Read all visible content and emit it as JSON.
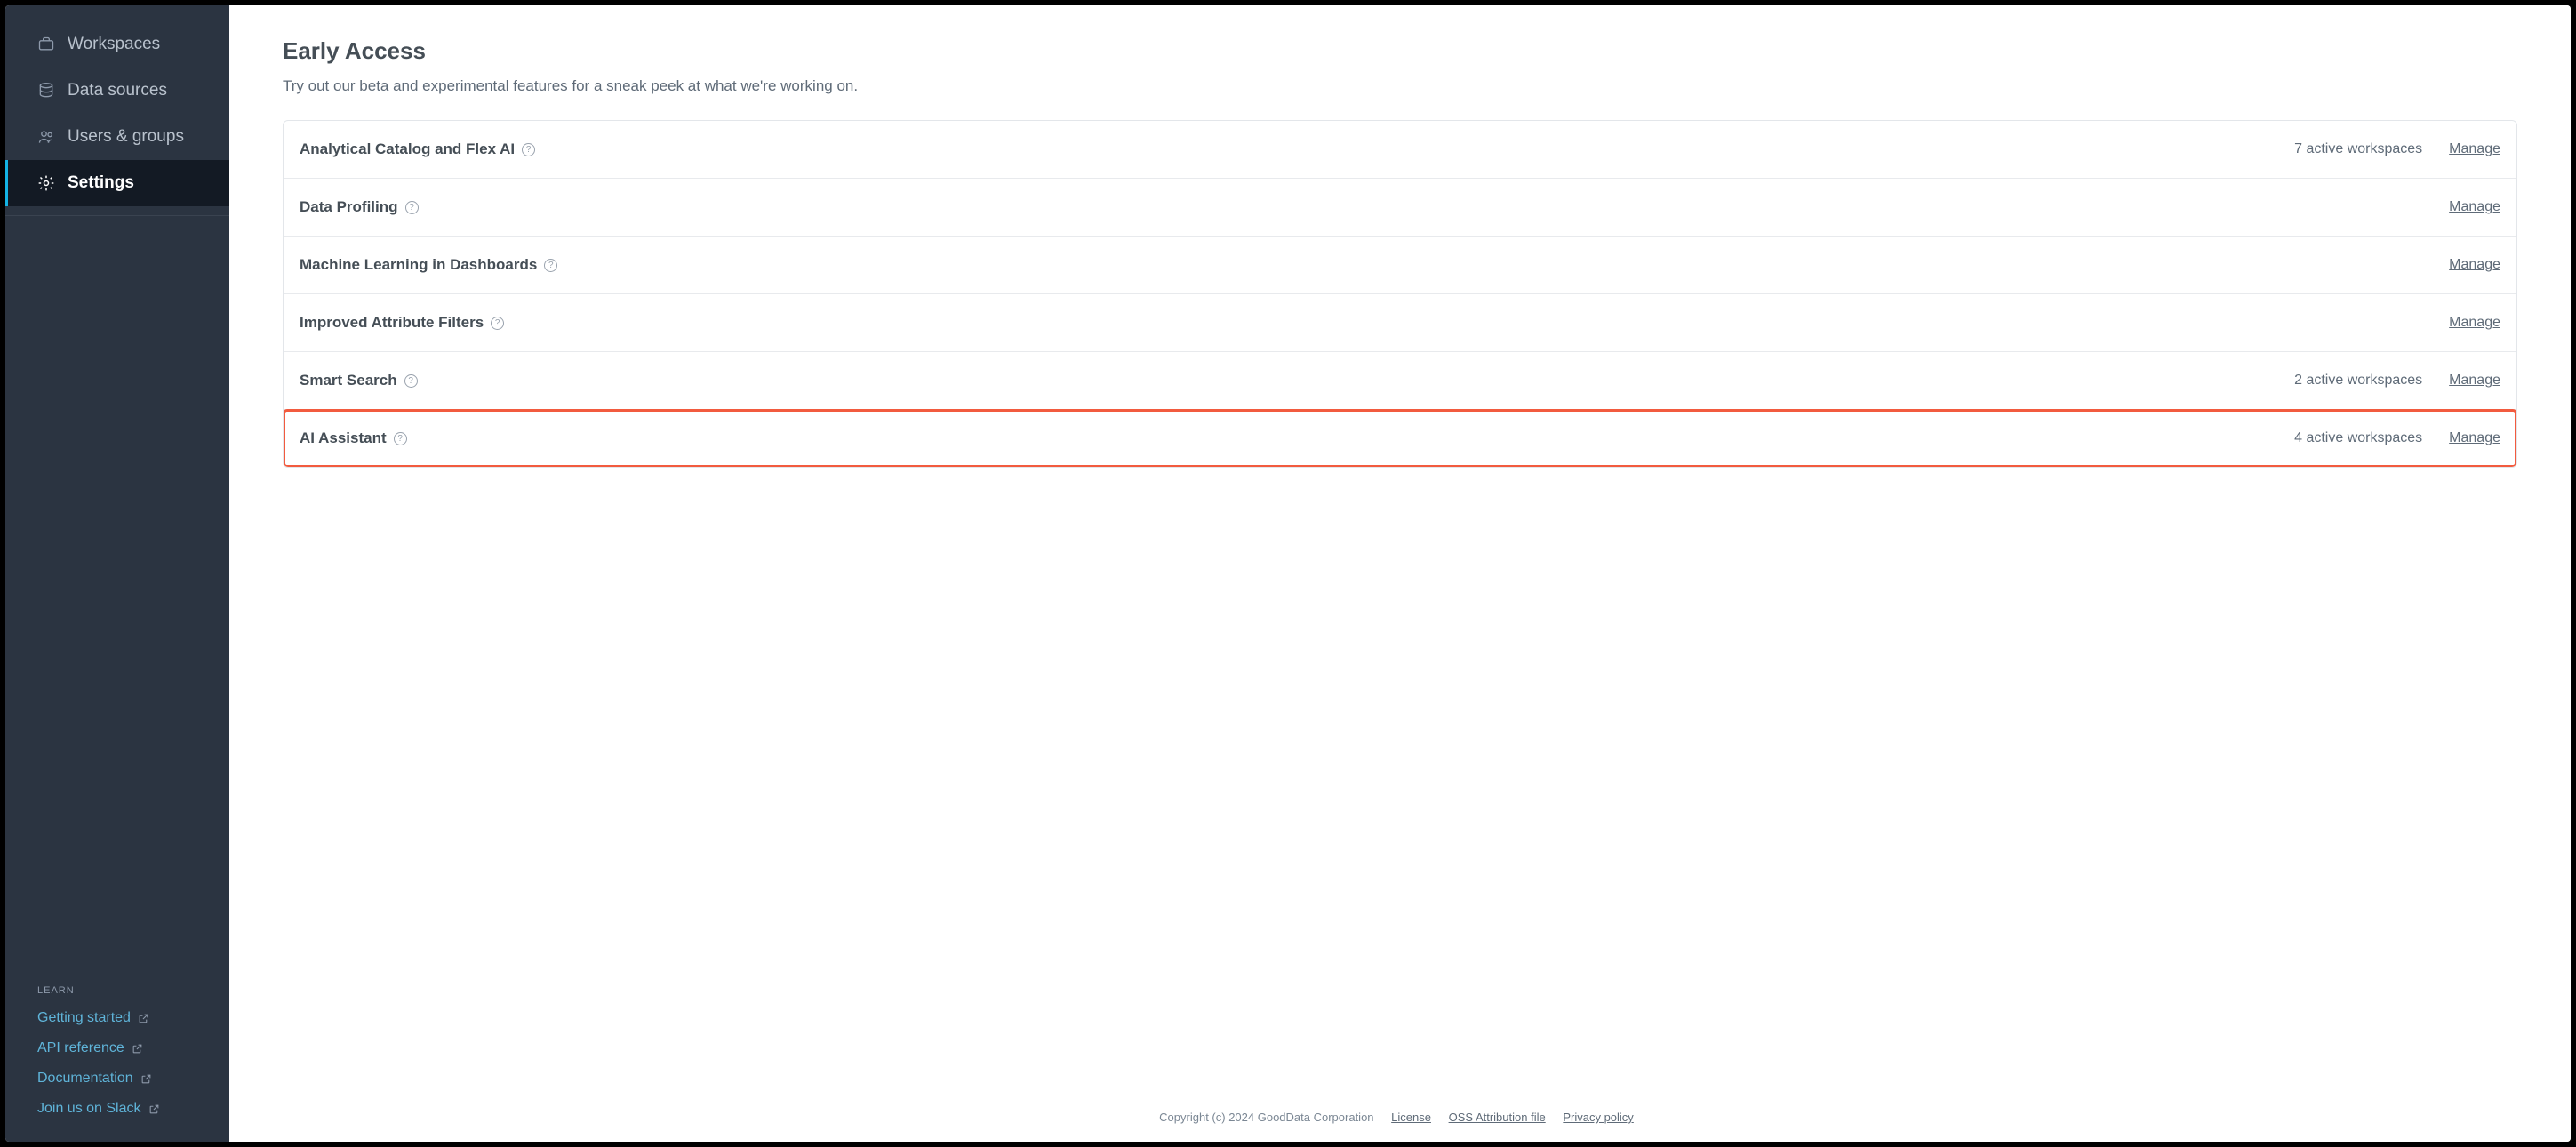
{
  "sidebar": {
    "items": [
      {
        "label": "Workspaces",
        "active": false
      },
      {
        "label": "Data sources",
        "active": false
      },
      {
        "label": "Users & groups",
        "active": false
      },
      {
        "label": "Settings",
        "active": true
      }
    ],
    "learn_heading": "LEARN",
    "learn_links": [
      {
        "label": "Getting started"
      },
      {
        "label": "API reference"
      },
      {
        "label": "Documentation"
      },
      {
        "label": "Join us on Slack"
      }
    ]
  },
  "page": {
    "title": "Early Access",
    "description": "Try out our beta and experimental features for a sneak peek at what we're working on."
  },
  "features": [
    {
      "name": "Analytical Catalog and Flex AI",
      "status": "7 active workspaces",
      "manage": "Manage",
      "highlight": false
    },
    {
      "name": "Data Profiling",
      "status": "",
      "manage": "Manage",
      "highlight": false
    },
    {
      "name": "Machine Learning in Dashboards",
      "status": "",
      "manage": "Manage",
      "highlight": false
    },
    {
      "name": "Improved Attribute Filters",
      "status": "",
      "manage": "Manage",
      "highlight": false
    },
    {
      "name": "Smart Search",
      "status": "2 active workspaces",
      "manage": "Manage",
      "highlight": false
    },
    {
      "name": "AI Assistant",
      "status": "4 active workspaces",
      "manage": "Manage",
      "highlight": true
    }
  ],
  "footer": {
    "copyright": "Copyright (c) 2024 GoodData Corporation",
    "links": [
      {
        "label": "License"
      },
      {
        "label": "OSS Attribution file"
      },
      {
        "label": "Privacy policy"
      }
    ]
  }
}
